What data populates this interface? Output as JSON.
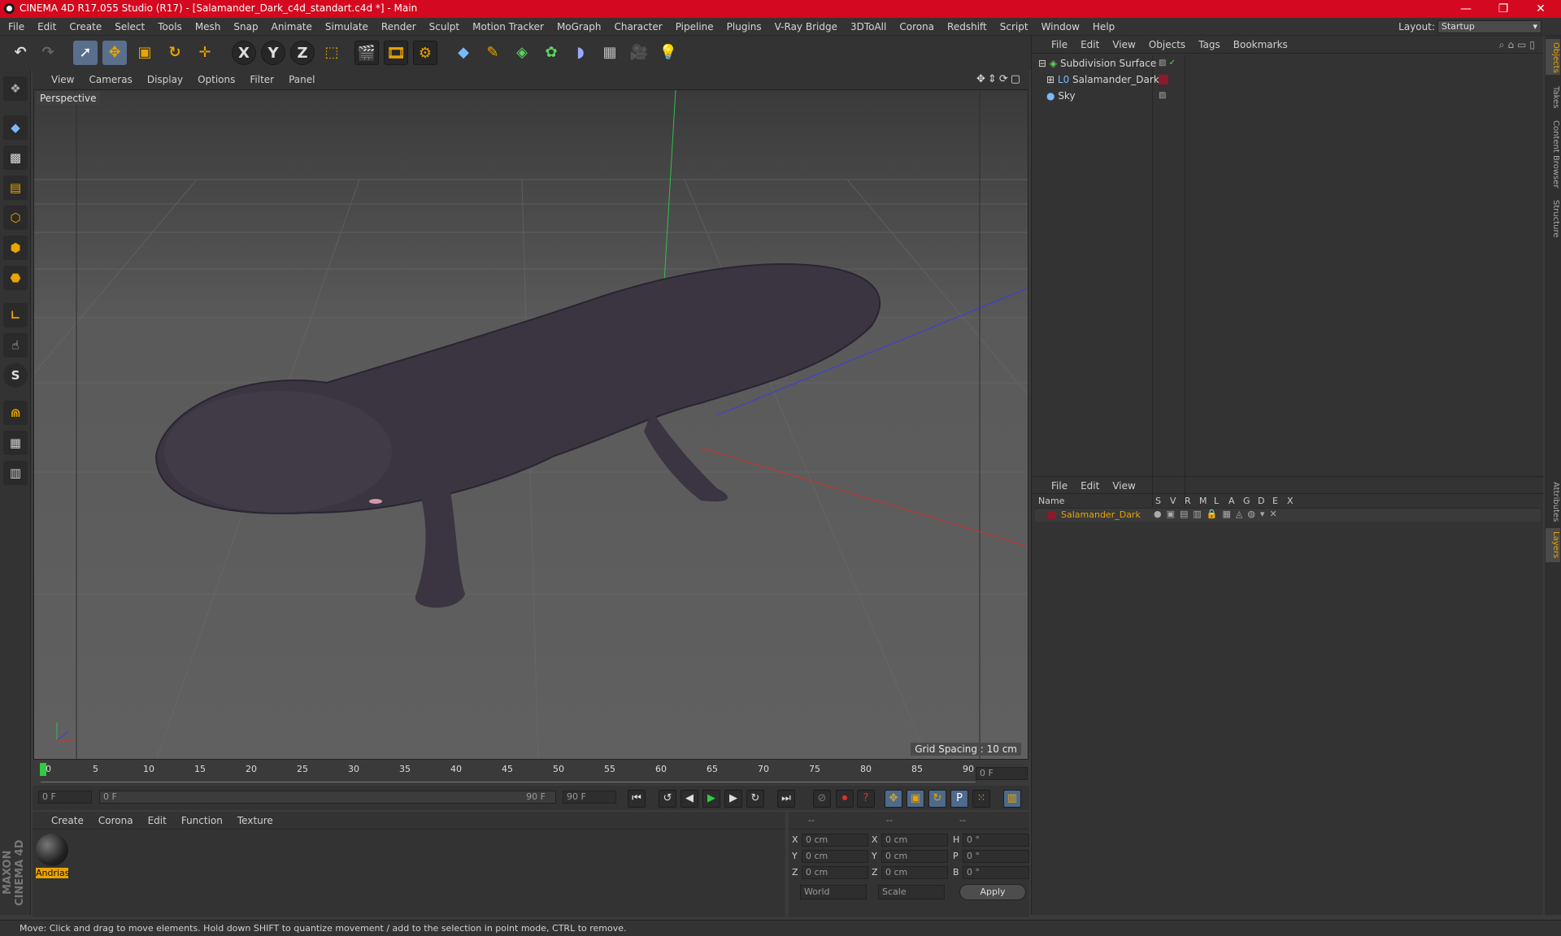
{
  "window": {
    "title": "CINEMA 4D R17.055 Studio (R17) - [Salamander_Dark_c4d_standart.c4d *] - Main",
    "controls": [
      "—",
      "❐",
      "✕"
    ]
  },
  "menubar": {
    "items": [
      "File",
      "Edit",
      "Create",
      "Select",
      "Tools",
      "Mesh",
      "Snap",
      "Animate",
      "Simulate",
      "Render",
      "Sculpt",
      "Motion Tracker",
      "MoGraph",
      "Character",
      "Pipeline",
      "Plugins",
      "V-Ray Bridge",
      "3DToAll",
      "Corona",
      "Redshift",
      "Script",
      "Window",
      "Help"
    ],
    "layout_label": "Layout:",
    "layout_value": "Startup"
  },
  "toolbar": {
    "axis_x": "X",
    "axis_y": "Y",
    "axis_z": "Z"
  },
  "viewport": {
    "menu": [
      "View",
      "Cameras",
      "Display",
      "Options",
      "Filter",
      "Panel"
    ],
    "label": "Perspective",
    "grid_spacing": "Grid Spacing : 10 cm"
  },
  "timeline": {
    "ticks": [
      "0",
      "5",
      "10",
      "15",
      "20",
      "25",
      "30",
      "35",
      "40",
      "45",
      "50",
      "55",
      "60",
      "65",
      "70",
      "75",
      "80",
      "85",
      "90"
    ],
    "current_frame": "0 F",
    "start_frame": "0 F",
    "range_start": "0 F",
    "range_end": "90 F",
    "end_frame": "90 F"
  },
  "material_panel": {
    "menu": [
      "Create",
      "Corona",
      "Edit",
      "Function",
      "Texture"
    ],
    "material_name": "Andrias"
  },
  "coord_panel": {
    "headers": [
      "--",
      "--",
      "--"
    ],
    "rows": [
      {
        "a": "X",
        "av": "0 cm",
        "b": "X",
        "bv": "0 cm",
        "c": "H",
        "cv": "0 °"
      },
      {
        "a": "Y",
        "av": "0 cm",
        "b": "Y",
        "bv": "0 cm",
        "c": "P",
        "cv": "0 °"
      },
      {
        "a": "Z",
        "av": "0 cm",
        "b": "Z",
        "bv": "0 cm",
        "c": "B",
        "cv": "0 °"
      }
    ],
    "world": "World",
    "scale": "Scale",
    "apply": "Apply"
  },
  "object_manager": {
    "menu": [
      "File",
      "Edit",
      "View",
      "Objects",
      "Tags",
      "Bookmarks"
    ],
    "objects": [
      "Subdivision Surface",
      "Salamander_Dark",
      "Sky"
    ]
  },
  "layer_manager": {
    "menu": [
      "File",
      "Edit",
      "View"
    ],
    "name_header": "Name",
    "columns": [
      "S",
      "V",
      "R",
      "M",
      "L",
      "A",
      "G",
      "D",
      "E",
      "X"
    ],
    "layer_name": "Salamander_Dark"
  },
  "side_tabs": {
    "top": [
      "Objects",
      "Takes",
      "Content Browser",
      "Structure"
    ],
    "bottom": [
      "Attributes",
      "Layers"
    ]
  },
  "branding": "MAXON CINEMA 4D",
  "status": "Move: Click and drag to move elements. Hold down SHIFT to quantize movement / add to the selection in point mode, CTRL to remove.",
  "colors": {
    "titlebar": "#d4081e",
    "accent_orange": "#e8a400",
    "layer_red": "#8b1a2a"
  }
}
